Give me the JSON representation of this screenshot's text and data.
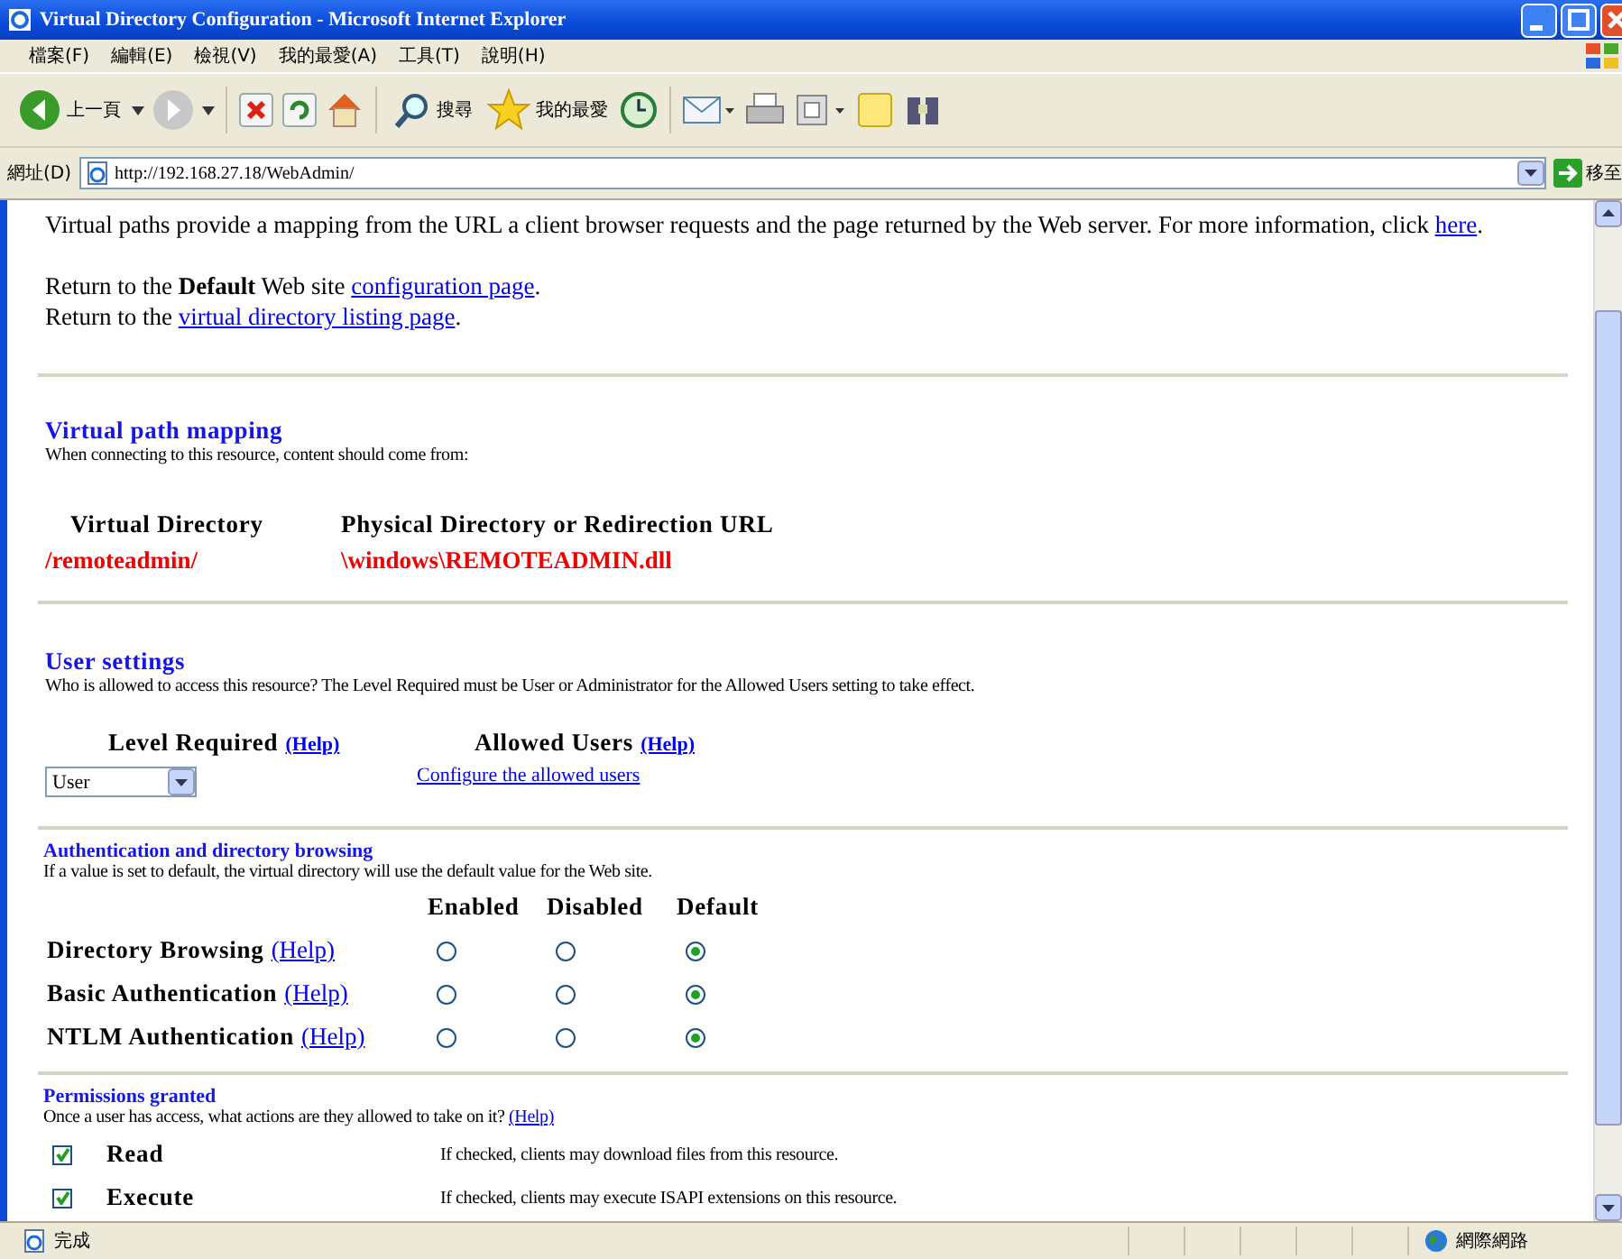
{
  "window": {
    "title": "Virtual Directory Configuration - Microsoft Internet Explorer"
  },
  "menu": [
    "檔案(F)",
    "編輯(E)",
    "檢視(V)",
    "我的最愛(A)",
    "工具(T)",
    "說明(H)"
  ],
  "toolbar": [
    {
      "kind": "back",
      "label": "上一頁"
    },
    {
      "kind": "forward"
    },
    {
      "kind": "stop"
    },
    {
      "kind": "refresh"
    },
    {
      "kind": "home"
    },
    {
      "kind": "search",
      "label": "搜尋"
    },
    {
      "kind": "favorites",
      "label": "我的最愛"
    },
    {
      "kind": "history"
    },
    {
      "kind": "mail"
    },
    {
      "kind": "print"
    },
    {
      "kind": "window"
    },
    {
      "kind": "note"
    },
    {
      "kind": "tools"
    }
  ],
  "address": {
    "label": "網址(D)",
    "value": "http://192.168.27.18/WebAdmin/",
    "go": "移至"
  },
  "intro": {
    "text": "Virtual paths provide a mapping from the URL a client browser requests and the page returned by the Web server. For more information, click",
    "link": "here",
    "after": "."
  },
  "return_links": [
    {
      "text": "Return to the **Default** Web site",
      "link": "configuration page",
      "after": "."
    },
    {
      "text": "Return to the",
      "link": "virtual directory listing page",
      "after": "."
    }
  ],
  "mapping": {
    "title": "Virtual path mapping",
    "description": "When connecting to this resource, content should come from:",
    "columns": [
      "Virtual Directory",
      "Physical Directory or Redirection URL"
    ],
    "row": [
      "/remoteadmin/",
      "\\windows\\REMOTEADMIN.dll"
    ]
  },
  "user_settings": {
    "title": "User settings",
    "description": "Who is allowed to access this resource? The Level Required must be User or Administrator for the Allowed Users setting to take effect.",
    "level_label": "Level Required",
    "level_help": "(Help)",
    "level_value": "User",
    "users_label": "Allowed Users",
    "users_help": "(Help)",
    "users_link": "Configure the allowed users"
  },
  "auth": {
    "title": "Authentication and directory browsing",
    "description": "If a value is set to default, the virtual directory will use the default value for the Web site.",
    "columns": [
      "Enabled",
      "Disabled",
      "Default"
    ],
    "rows": [
      {
        "label": "Directory Browsing",
        "help": "(Help)",
        "options": [
          {
            "selected": false
          },
          {
            "selected": false
          },
          {
            "selected": true
          }
        ]
      },
      {
        "label": "Basic Authentication",
        "help": "(Help)",
        "options": [
          {
            "selected": false
          },
          {
            "selected": false
          },
          {
            "selected": true
          }
        ]
      },
      {
        "label": "NTLM Authentication",
        "help": "(Help)",
        "options": [
          {
            "selected": false
          },
          {
            "selected": false
          },
          {
            "selected": true
          }
        ]
      }
    ]
  },
  "permissions": {
    "title": "Permissions granted",
    "description": "Once a user has access, what actions are they allowed to take on it?",
    "help": "(Help)",
    "items": [
      {
        "label": "Read",
        "description": "If checked, clients may download files from this resource.",
        "checked": true
      },
      {
        "label": "Execute",
        "description": "If checked, clients may execute ISAPI extensions on this resource.",
        "checked": true
      }
    ]
  },
  "status_bar": {
    "text": "完成",
    "zone": "網際網路"
  }
}
